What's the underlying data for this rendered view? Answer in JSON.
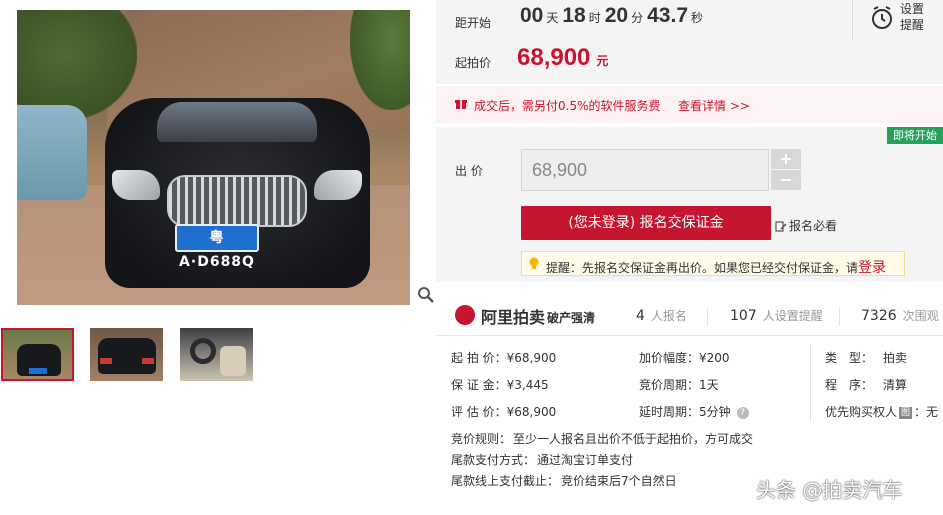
{
  "gallery": {
    "plate_text": "粤A·D688Q",
    "thumbnails": [
      {
        "name": "front"
      },
      {
        "name": "rear"
      },
      {
        "name": "interior"
      }
    ]
  },
  "countdown": {
    "label": "距开始",
    "days": "00",
    "days_unit": "天",
    "hours": "18",
    "hours_unit": "时",
    "minutes": "20",
    "minutes_unit": "分",
    "seconds": "43.7",
    "seconds_unit": "秒"
  },
  "start_price": {
    "label": "起拍价",
    "value": "68,900",
    "currency": "元"
  },
  "alarm": {
    "label_line1": "设置",
    "label_line2": "提醒"
  },
  "notice": {
    "text": "成交后，需另付0.5%的软件服务费",
    "link": "查看详情 >>"
  },
  "bid": {
    "badge": "即将开始",
    "label": "出 价",
    "input_value": "68,900",
    "plus": "+",
    "minus": "−",
    "register_button": "(您未登录) 报名交保证金",
    "must_read": "报名必看"
  },
  "tip": {
    "text": "提醒：先报名交保证金再出价。如果您已经交付保证金，请",
    "link": "登录"
  },
  "platform": {
    "name": "阿里拍卖",
    "sub": "破产强清",
    "stats": [
      {
        "num": "4",
        "label": "人报名"
      },
      {
        "num": "107",
        "label": "人设置提醒"
      },
      {
        "num": "7326",
        "label": "次围观"
      }
    ]
  },
  "details": {
    "col1": [
      {
        "label": "起 拍 价：",
        "value": "¥68,900"
      },
      {
        "label": "保 证 金：",
        "value": "¥3,445"
      },
      {
        "label": "评 估 价：",
        "value": "¥68,900"
      }
    ],
    "col2": [
      {
        "label": "加价幅度：",
        "value": "¥200"
      },
      {
        "label": "竞价周期：",
        "value": "1天"
      },
      {
        "label": "延时周期：",
        "value": "5分钟"
      }
    ],
    "col3": [
      {
        "label": "类　型：",
        "value": "拍卖"
      },
      {
        "label": "程　序：",
        "value": "清算"
      },
      {
        "label": "优先购买权人",
        "badge": "图",
        "value": "：无"
      }
    ]
  },
  "rules": [
    {
      "label": "竞价规则：",
      "value": "至少一人报名且出价不低于起拍价，方可成交"
    },
    {
      "label": "尾款支付方式：",
      "value": "通过淘宝订单支付"
    },
    {
      "label": "尾款线上支付截止：",
      "value": "竞价结束后7个自然日"
    }
  ],
  "watermark": "头条 @拍卖汽车",
  "colors": {
    "accent": "#c6162f",
    "badge_green": "#25a35a",
    "tip_bg": "#fffbe8"
  }
}
